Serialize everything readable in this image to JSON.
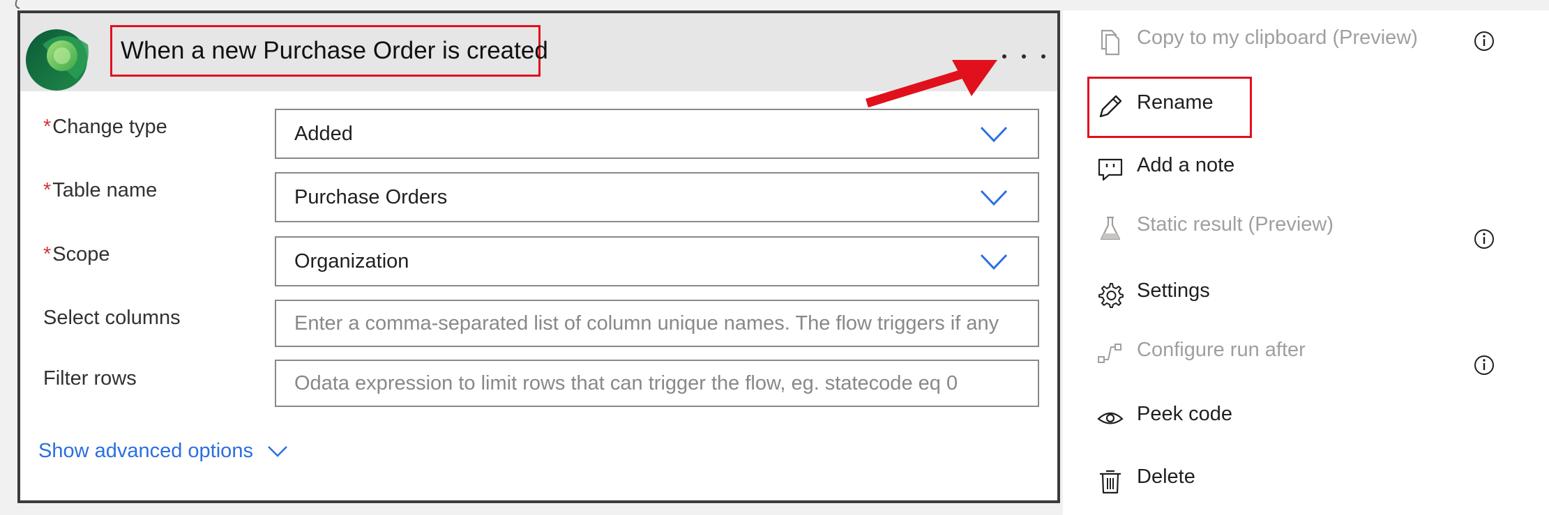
{
  "trigger": {
    "title": "When a new Purchase Order is created",
    "more_options_icon": "more-horizontal-icon",
    "logo_icon": "dataverse-logo-icon",
    "fields": [
      {
        "label": "Change type",
        "required": true,
        "value": "Added",
        "type": "dropdown"
      },
      {
        "label": "Table name",
        "required": true,
        "value": "Purchase Orders",
        "type": "dropdown"
      },
      {
        "label": "Scope",
        "required": true,
        "value": "Organization",
        "type": "dropdown"
      },
      {
        "label": "Select columns",
        "required": false,
        "placeholder": "Enter a comma-separated list of column unique names. The flow triggers if any",
        "type": "text"
      },
      {
        "label": "Filter rows",
        "required": false,
        "placeholder": "Odata expression to limit rows that can trigger the flow, eg. statecode eq 0",
        "type": "text"
      }
    ],
    "required_marker": "*",
    "show_advanced_label": "Show advanced options"
  },
  "menu": {
    "items": [
      {
        "label": "Copy to my clipboard (Preview)",
        "icon": "copy-icon",
        "disabled": true,
        "info": true
      },
      {
        "label": "Rename",
        "icon": "pencil-icon",
        "disabled": false,
        "info": false,
        "highlighted": true
      },
      {
        "label": "Add a note",
        "icon": "comment-icon",
        "disabled": false,
        "info": false
      },
      {
        "label": "Static result (Preview)",
        "icon": "flask-icon",
        "disabled": true,
        "info": true
      },
      {
        "label": "Settings",
        "icon": "gear-icon",
        "disabled": false,
        "info": false
      },
      {
        "label": "Configure run after",
        "icon": "run-after-icon",
        "disabled": true,
        "info": true
      },
      {
        "label": "Peek code",
        "icon": "eye-icon",
        "disabled": false,
        "info": false
      },
      {
        "label": "Delete",
        "icon": "trash-icon",
        "disabled": false,
        "info": false
      }
    ]
  },
  "colors": {
    "highlight": "#e0101c",
    "link": "#2b6fe0",
    "chevron": "#2b6fe0",
    "required": "#d13438",
    "disabled_text": "#a19f9d"
  }
}
